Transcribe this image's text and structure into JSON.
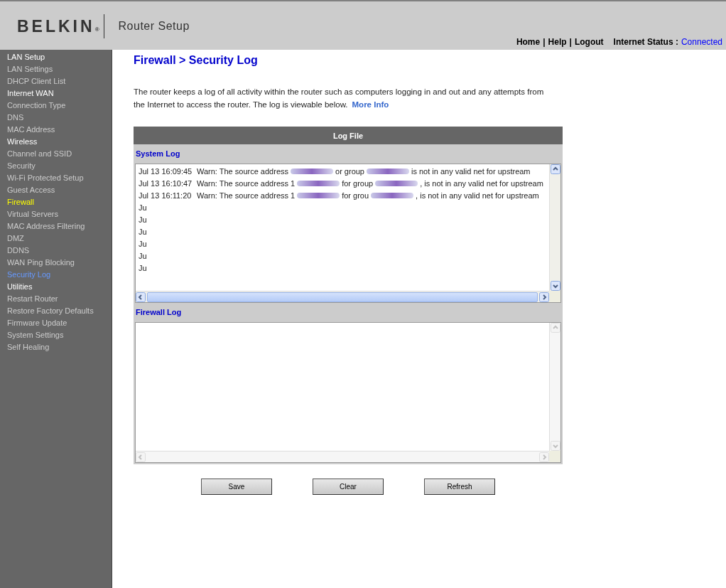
{
  "header": {
    "logo": "BELKIN",
    "logo_mark": "®",
    "title": "Router Setup",
    "links": [
      {
        "label": "Home",
        "separator": "|"
      },
      {
        "label": "Help",
        "separator": "|"
      },
      {
        "label": "Logout"
      }
    ],
    "status_label": "Internet Status :",
    "status_value": "Connected"
  },
  "sidebar": {
    "items": [
      {
        "label": "LAN Setup",
        "kind": "header",
        "selected": false
      },
      {
        "label": "LAN Settings",
        "kind": "item",
        "selected": false
      },
      {
        "label": "DHCP Client List",
        "kind": "item",
        "selected": false
      },
      {
        "label": "Internet WAN",
        "kind": "header",
        "selected": false
      },
      {
        "label": "Connection Type",
        "kind": "item",
        "selected": false
      },
      {
        "label": "DNS",
        "kind": "item",
        "selected": false
      },
      {
        "label": "MAC Address",
        "kind": "item",
        "selected": false
      },
      {
        "label": "Wireless",
        "kind": "header",
        "selected": false
      },
      {
        "label": "Channel and SSID",
        "kind": "item",
        "selected": false
      },
      {
        "label": "Security",
        "kind": "item",
        "selected": false
      },
      {
        "label": "Wi-Fi Protected Setup",
        "kind": "item",
        "selected": false
      },
      {
        "label": "Guest Access",
        "kind": "item",
        "selected": false
      },
      {
        "label": "Firewall",
        "kind": "header",
        "selected": true
      },
      {
        "label": "Virtual Servers",
        "kind": "item",
        "selected": false
      },
      {
        "label": "MAC Address Filtering",
        "kind": "item",
        "selected": false
      },
      {
        "label": "DMZ",
        "kind": "item",
        "selected": false
      },
      {
        "label": "DDNS",
        "kind": "item",
        "selected": false
      },
      {
        "label": "WAN Ping Blocking",
        "kind": "item",
        "selected": false
      },
      {
        "label": "Security Log",
        "kind": "item",
        "selected": true
      },
      {
        "label": "Utilities",
        "kind": "header",
        "selected": false
      },
      {
        "label": "Restart Router",
        "kind": "item",
        "selected": false
      },
      {
        "label": "Restore Factory Defaults",
        "kind": "item",
        "selected": false
      },
      {
        "label": "Firmware Update",
        "kind": "item",
        "selected": false
      },
      {
        "label": "System Settings",
        "kind": "item",
        "selected": false
      },
      {
        "label": "Self Healing",
        "kind": "item",
        "selected": false
      }
    ]
  },
  "page": {
    "title": "Firewall > Security Log",
    "description": "The router keeps a log of all activity within the router such as computers logging in and out and any attempts from the Internet to access the router. The log is viewable below.",
    "more_info": "More Info"
  },
  "log_panel": {
    "title": "Log File",
    "system_log": {
      "label": "System Log",
      "rows": [
        {
          "time": "Jul 13 16:09:45",
          "message": [
            "Warn: The source address",
            "or group",
            "is not in any valid net for upstream"
          ]
        },
        {
          "time": "Jul 13 16:10:47",
          "message": [
            "Warn: The source address 1",
            "for group",
            ", is not in any valid net for upstream"
          ]
        },
        {
          "time": "Jul 13 16:11:20",
          "message": [
            "Warn: The source address 1",
            "for grou",
            ", is not in any valid net for upstream"
          ]
        },
        {
          "time": "Ju"
        },
        {
          "time": "Ju"
        },
        {
          "time": "Ju"
        },
        {
          "time": "Ju"
        },
        {
          "time": "Ju"
        },
        {
          "time": "Ju"
        }
      ]
    },
    "firewall_log": {
      "label": "Firewall Log"
    }
  },
  "buttons": [
    "Save",
    "Clear",
    "Refresh"
  ]
}
